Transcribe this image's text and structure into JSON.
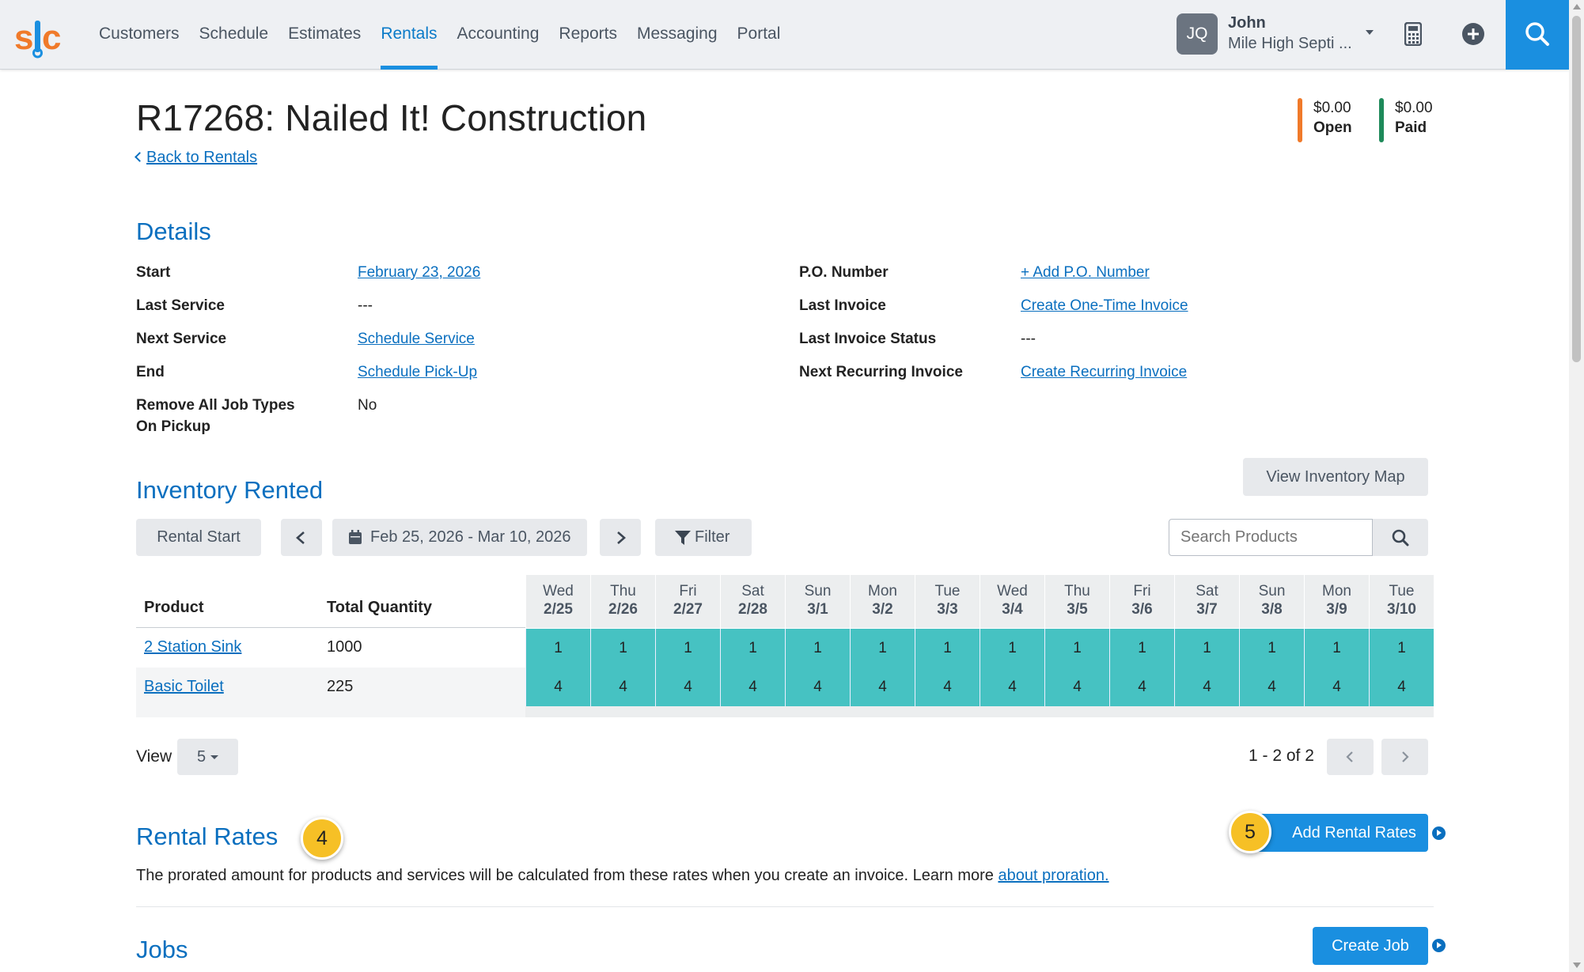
{
  "nav": {
    "logo_text": "s|c",
    "items": [
      {
        "label": "Customers",
        "active": false
      },
      {
        "label": "Schedule",
        "active": false
      },
      {
        "label": "Estimates",
        "active": false
      },
      {
        "label": "Rentals",
        "active": true
      },
      {
        "label": "Accounting",
        "active": false
      },
      {
        "label": "Reports",
        "active": false
      },
      {
        "label": "Messaging",
        "active": false
      },
      {
        "label": "Portal",
        "active": false
      }
    ],
    "user": {
      "initials": "JQ",
      "name": "John",
      "company": "Mile High Septi ..."
    }
  },
  "header": {
    "title": "R17268: Nailed It! Construction",
    "back_label": "Back to Rentals",
    "open": {
      "amount": "$0.00",
      "label": "Open",
      "color": "#f07a2a"
    },
    "paid": {
      "amount": "$0.00",
      "label": "Paid",
      "color": "#1e8a5a"
    }
  },
  "details": {
    "heading": "Details",
    "left": [
      {
        "label": "Start",
        "value": "February 23, 2026"
      },
      {
        "label": "Last Service",
        "value": "---"
      },
      {
        "label": "Next Service",
        "value": "Schedule Service"
      },
      {
        "label": "End",
        "value": "Schedule Pick-Up"
      },
      {
        "label": "Remove All Job Types",
        "label2": "On Pickup",
        "value": "No"
      }
    ],
    "right": [
      {
        "label": "P.O. Number",
        "value": "+ Add P.O. Number"
      },
      {
        "label": "Last Invoice",
        "value": "Create One-Time Invoice"
      },
      {
        "label": "Last Invoice Status",
        "value": "---"
      },
      {
        "label": "Next Recurring Invoice",
        "value": "Create Recurring Invoice"
      }
    ]
  },
  "inventory": {
    "heading": "Inventory Rented",
    "view_map_label": "View Inventory Map",
    "rental_start_label": "Rental Start",
    "date_range": "Feb 25, 2026 - Mar 10, 2026",
    "filter_label": "Filter",
    "search_placeholder": "Search Products",
    "col_product": "Product",
    "col_total": "Total Quantity",
    "days": [
      {
        "dow": "Wed",
        "date": "2/25"
      },
      {
        "dow": "Thu",
        "date": "2/26"
      },
      {
        "dow": "Fri",
        "date": "2/27"
      },
      {
        "dow": "Sat",
        "date": "2/28"
      },
      {
        "dow": "Sun",
        "date": "3/1"
      },
      {
        "dow": "Mon",
        "date": "3/2"
      },
      {
        "dow": "Tue",
        "date": "3/3"
      },
      {
        "dow": "Wed",
        "date": "3/4"
      },
      {
        "dow": "Thu",
        "date": "3/5"
      },
      {
        "dow": "Fri",
        "date": "3/6"
      },
      {
        "dow": "Sat",
        "date": "3/7"
      },
      {
        "dow": "Sun",
        "date": "3/8"
      },
      {
        "dow": "Mon",
        "date": "3/9"
      },
      {
        "dow": "Tue",
        "date": "3/10"
      }
    ],
    "rows": [
      {
        "product": "2 Station Sink",
        "total": "1000",
        "daily": [
          "1",
          "1",
          "1",
          "1",
          "1",
          "1",
          "1",
          "1",
          "1",
          "1",
          "1",
          "1",
          "1",
          "1"
        ]
      },
      {
        "product": "Basic Toilet",
        "total": "225",
        "daily": [
          "4",
          "4",
          "4",
          "4",
          "4",
          "4",
          "4",
          "4",
          "4",
          "4",
          "4",
          "4",
          "4",
          "4"
        ]
      }
    ],
    "view_label": "View",
    "page_size": "5",
    "pagination": "1 - 2 of 2"
  },
  "rental_rates": {
    "heading": "Rental Rates",
    "badge": "4",
    "add_label": "Add Rental Rates",
    "add_badge": "5",
    "description": "The prorated amount for products and services will be calculated from these rates when you create an invoice. Learn more ",
    "link": "about proration."
  },
  "jobs": {
    "heading": "Jobs",
    "create_label": "Create Job"
  },
  "colors": {
    "accent": "#1a8fe0",
    "link": "#0a6fbf",
    "teal_cell": "#46c2c2",
    "badge": "#f6c026"
  }
}
